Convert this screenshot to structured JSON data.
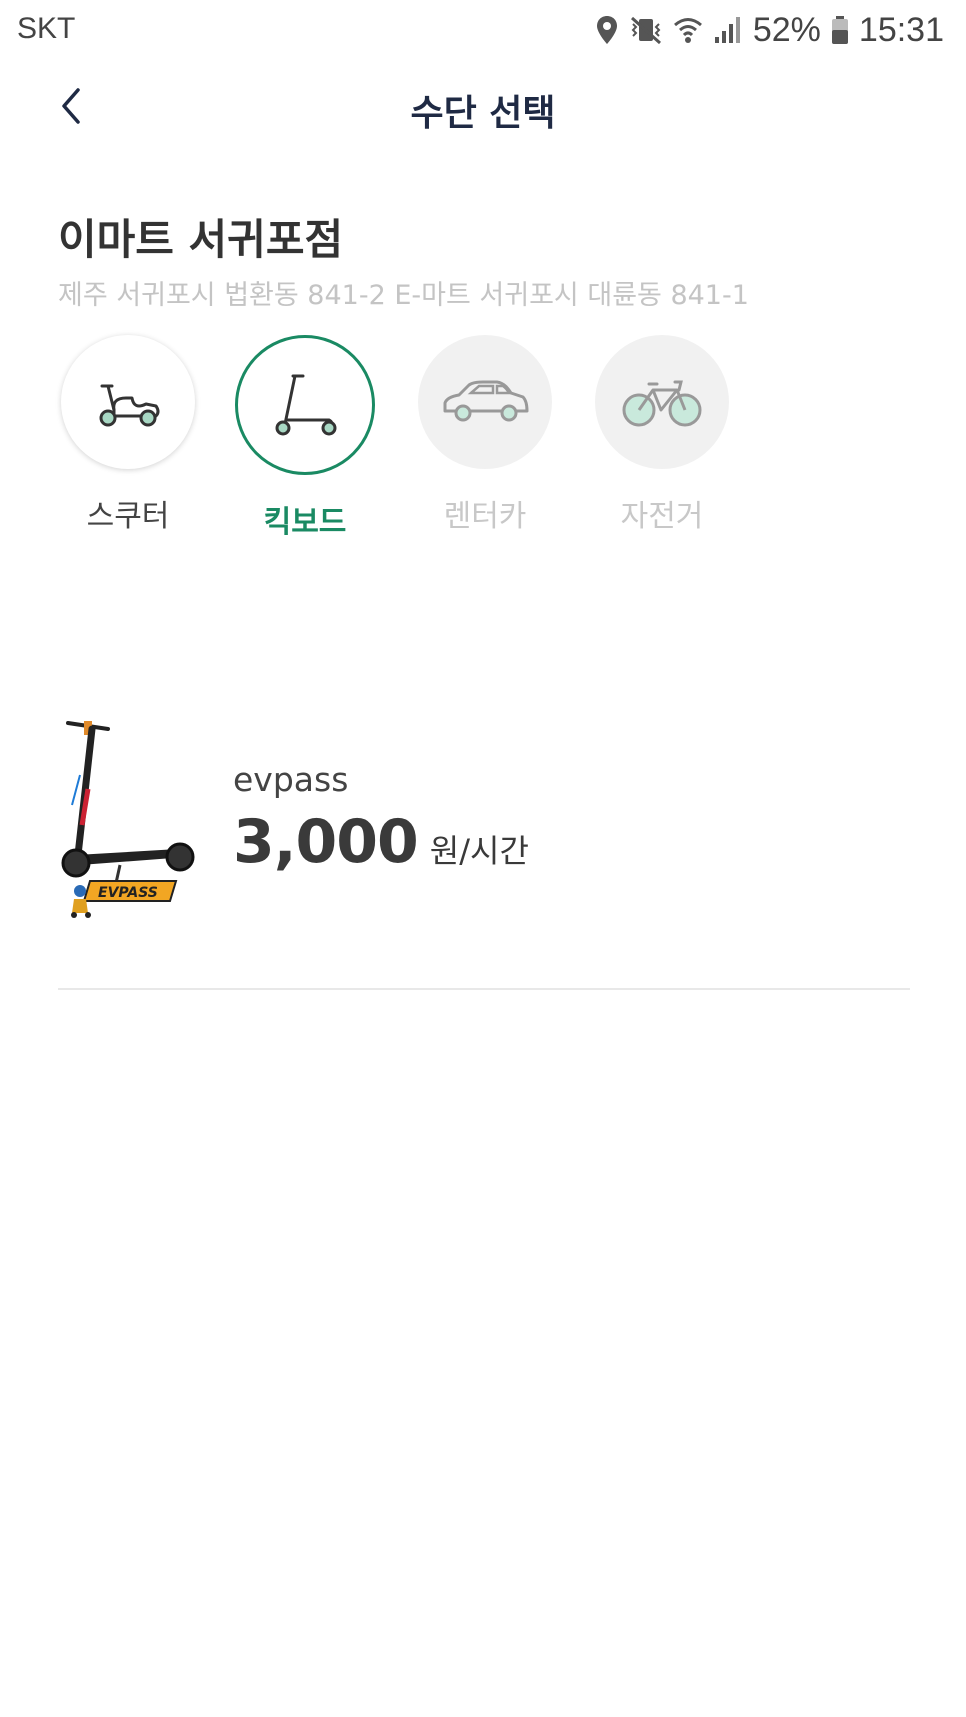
{
  "status_bar": {
    "carrier": "SKT",
    "battery": "52%",
    "time": "15:31"
  },
  "header": {
    "title": "수단 선택"
  },
  "store": {
    "name": "이마트 서귀포점",
    "address": "제주 서귀포시 법환동 841-2 E-마트 서귀포시 대륜동 841-1"
  },
  "modes": [
    {
      "label": "스쿠터",
      "icon": "scooter-icon",
      "state": "normal"
    },
    {
      "label": "킥보드",
      "icon": "kickboard-icon",
      "state": "selected"
    },
    {
      "label": "렌터카",
      "icon": "car-icon",
      "state": "disabled"
    },
    {
      "label": "자전거",
      "icon": "bicycle-icon",
      "state": "disabled"
    }
  ],
  "vehicle": {
    "name": "evpass",
    "price": "3,000",
    "unit": "원/시간",
    "logo_text": "EVPASS"
  },
  "colors": {
    "accent": "#1a8a63",
    "title": "#1f2a44",
    "wheel_tint": "#a8d8c4"
  }
}
